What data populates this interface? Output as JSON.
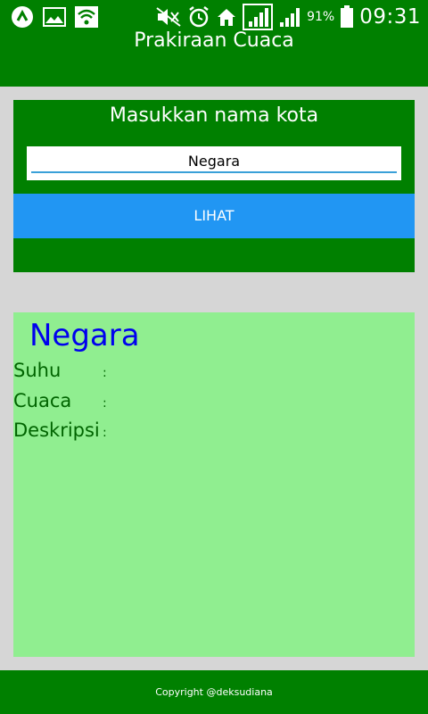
{
  "status_bar": {
    "battery_percent": "91%",
    "time": "09:31",
    "left_icons": [
      "app-launcher-icon",
      "gallery-icon",
      "wifi-icon"
    ],
    "right_icons": [
      "mute-icon",
      "alarm-icon",
      "home-icon",
      "signal-icon",
      "signal-icon",
      "battery-icon"
    ]
  },
  "app_bar": {
    "title": "Prakiraan Cuaca"
  },
  "search": {
    "heading": "Masukkan nama kota",
    "input_value": "Negara",
    "button_label": "LIHAT"
  },
  "result": {
    "city": "Negara",
    "rows": [
      {
        "label": "Suhu",
        "colon": ":",
        "value": ""
      },
      {
        "label": "Cuaca",
        "colon": ":",
        "value": ""
      },
      {
        "label": "Deskripsi",
        "colon": ":",
        "value": ""
      }
    ]
  },
  "footer": {
    "text": "Copyright @deksudiana"
  },
  "colors": {
    "primary_green": "#008000",
    "button_blue": "#2196f3",
    "result_bg": "#90ee90",
    "city_blue": "#0000ee",
    "label_green": "#006400"
  }
}
